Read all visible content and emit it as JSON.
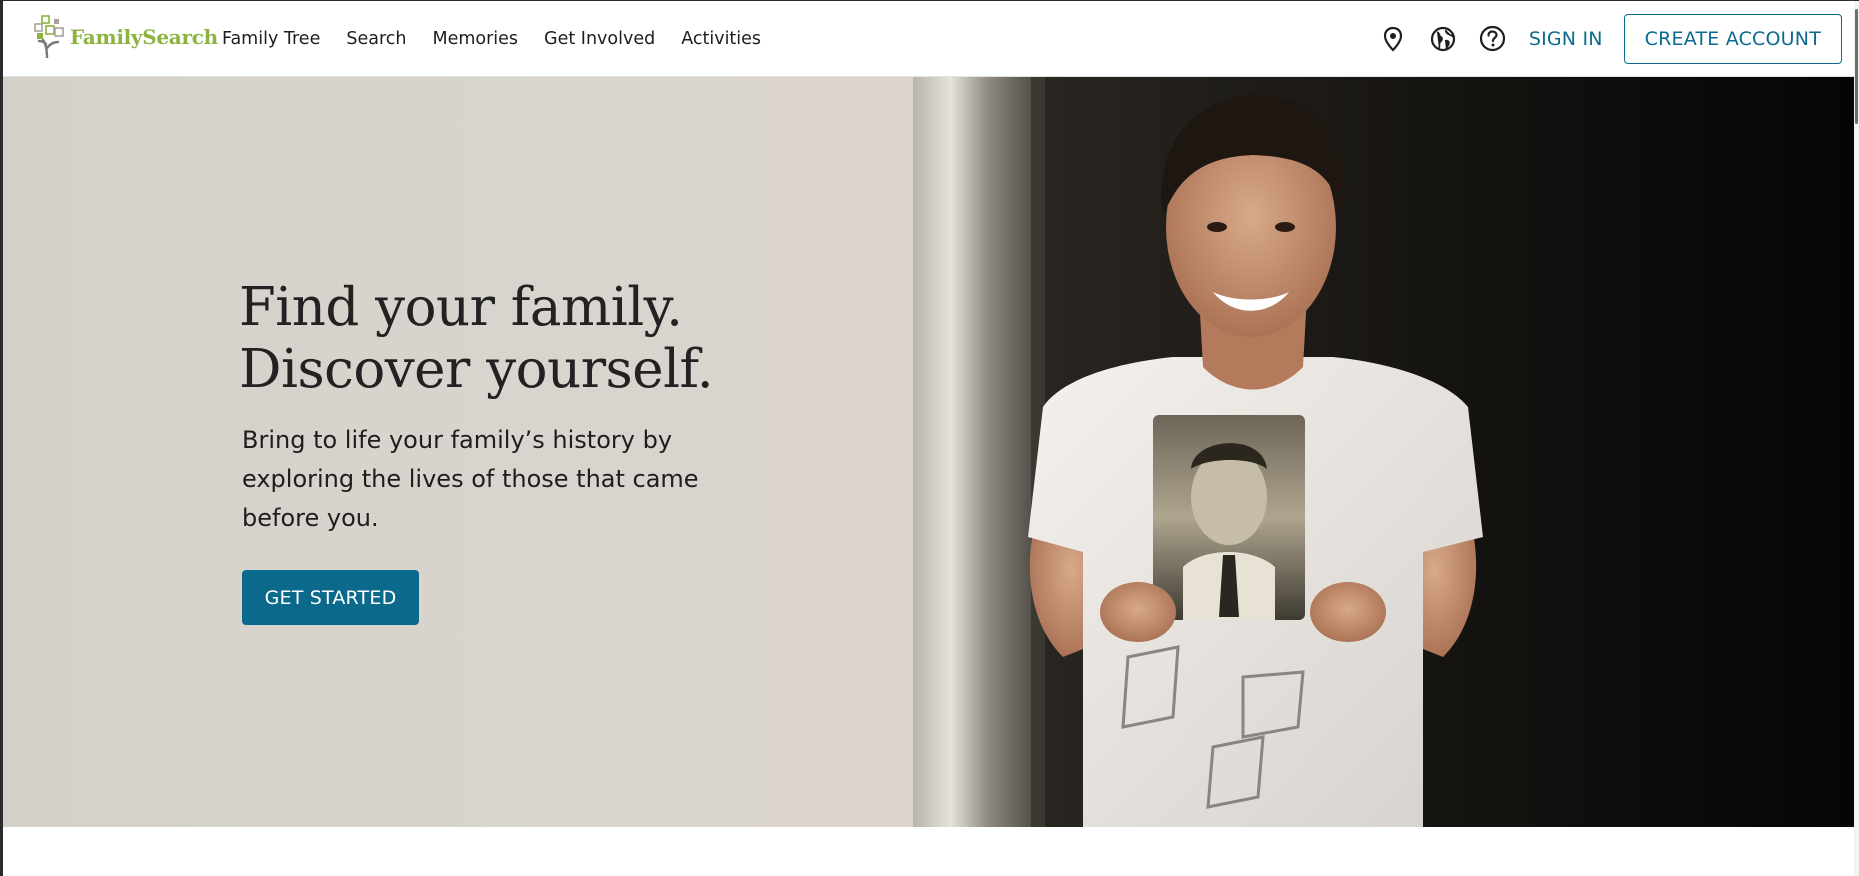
{
  "header": {
    "logo_text": "FamilySearch",
    "nav_items": [
      {
        "label": "Family Tree"
      },
      {
        "label": "Search"
      },
      {
        "label": "Memories"
      },
      {
        "label": "Get Involved"
      },
      {
        "label": "Activities"
      }
    ],
    "icons": [
      "location-pin-icon",
      "globe-icon",
      "help-icon"
    ],
    "sign_in_label": "SIGN IN",
    "create_account_label": "CREATE ACCOUNT"
  },
  "hero": {
    "title_line1": "Find your family.",
    "title_line2": "Discover yourself.",
    "subtitle": "Bring to life your family’s history by exploring the lives of those that came before you.",
    "cta_label": "GET STARTED",
    "image_description_icon": "hero-photo"
  },
  "colors": {
    "brand_green": "#8cb23f",
    "accent_blue": "#0b6a8c",
    "text_dark": "#1e1e1e"
  }
}
